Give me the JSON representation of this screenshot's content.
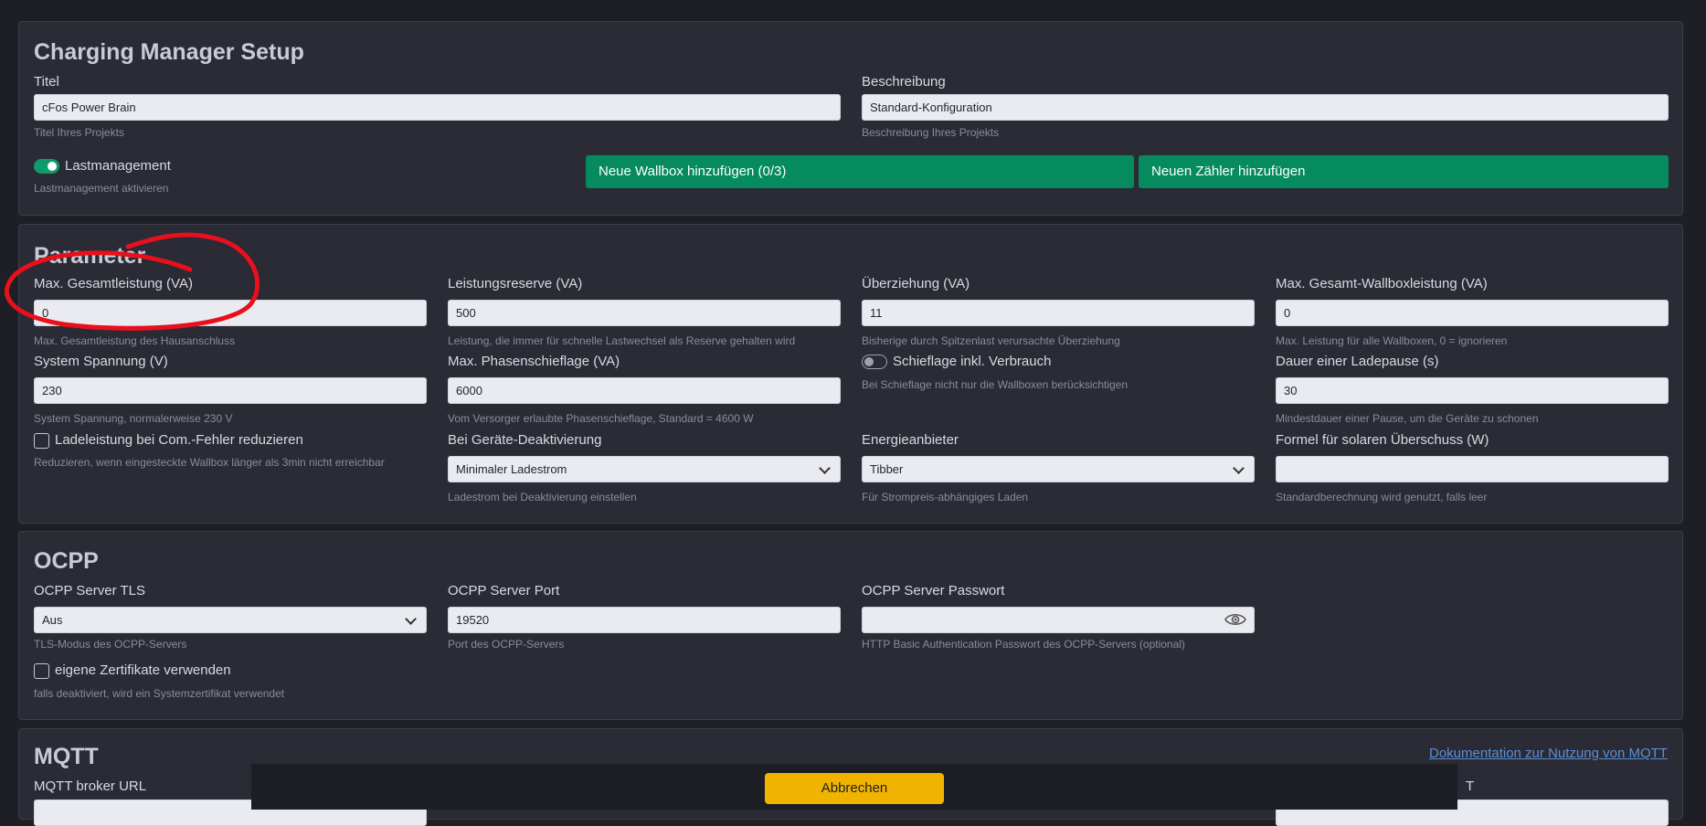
{
  "setup": {
    "title": "Charging Manager Setup",
    "titel_label": "Titel",
    "titel_value": "cFos Power Brain",
    "titel_help": "Titel Ihres Projekts",
    "beschreibung_label": "Beschreibung",
    "beschreibung_value": "Standard-Konfiguration",
    "beschreibung_help": "Beschreibung Ihres Projekts",
    "lastmanagement_label": "Lastmanagement",
    "lastmanagement_help": "Lastmanagement aktivieren",
    "lastmanagement_on": true,
    "add_wallbox_label": "Neue Wallbox hinzufügen (0/3)",
    "add_meter_label": "Neuen Zähler hinzufügen"
  },
  "parameter": {
    "title": "Parameter",
    "fields": [
      {
        "label": "Max. Gesamtleistung (VA)",
        "value": "0",
        "help": "Max. Gesamtleistung des Hausanschluss"
      },
      {
        "label": "Leistungsreserve (VA)",
        "value": "500",
        "help": "Leistung, die immer für schnelle Lastwechsel als Reserve gehalten wird"
      },
      {
        "label": "Überziehung (VA)",
        "value": "11",
        "help": "Bisherige durch Spitzenlast verursachte Überziehung"
      },
      {
        "label": "Max. Gesamt-Wallboxleistung (VA)",
        "value": "0",
        "help": "Max. Leistung für alle Wallboxen, 0 = ignorieren"
      },
      {
        "label": "System Spannung (V)",
        "value": "230",
        "help": "System Spannung, normalerweise 230 V"
      },
      {
        "label": "Max. Phasenschieflage (VA)",
        "value": "6000",
        "help": "Vom Versorger erlaubte Phasenschieflage, Standard = 4600 W"
      },
      {
        "label": "Schieflage inkl. Verbrauch",
        "value": "",
        "help": "Bei Schieflage nicht nur die Wallboxen berücksichtigen"
      },
      {
        "label": "Dauer einer Ladepause (s)",
        "value": "30",
        "help": "Mindestdauer einer Pause, um die Geräte zu schonen"
      },
      {
        "label": "Ladeleistung bei Com.-Fehler reduzieren",
        "value": "",
        "help": "Reduzieren, wenn eingesteckte Wallbox länger als 3min nicht erreichbar"
      },
      {
        "label": "Bei Geräte-Deaktivierung",
        "value": "Minimaler Ladestrom",
        "help": "Ladestrom bei Deaktivierung einstellen"
      },
      {
        "label": "Energieanbieter",
        "value": "Tibber",
        "help": "Für Strompreis-abhängiges Laden"
      },
      {
        "label": "Formel für solaren Überschuss (W)",
        "value": "",
        "help": "Standardberechnung wird genutzt, falls leer"
      }
    ]
  },
  "ocpp": {
    "title": "OCPP",
    "tls_label": "OCPP Server TLS",
    "tls_value": "Aus",
    "tls_help": "TLS-Modus des OCPP-Servers",
    "port_label": "OCPP Server Port",
    "port_value": "19520",
    "port_help": "Port des OCPP-Servers",
    "password_label": "OCPP Server Passwort",
    "password_value": "",
    "password_help": "HTTP Basic Authentication Passwort des OCPP-Servers (optional)",
    "cert_label": "eigene Zertifikate verwenden",
    "cert_help": "falls deaktiviert, wird ein Systemzertifikat verwendet"
  },
  "mqtt": {
    "title": "MQTT",
    "doc_link": "Dokumentation zur Nutzung von MQTT",
    "broker_label": "MQTT broker URL",
    "right_label_fragment": "T"
  },
  "footer": {
    "cancel_label": "Abbrechen"
  },
  "colors": {
    "background": "#1d1f24",
    "card": "#2a2b35",
    "green_button": "#058b5e",
    "cancel_button": "#f0b400",
    "annotation": "#e8101c"
  }
}
